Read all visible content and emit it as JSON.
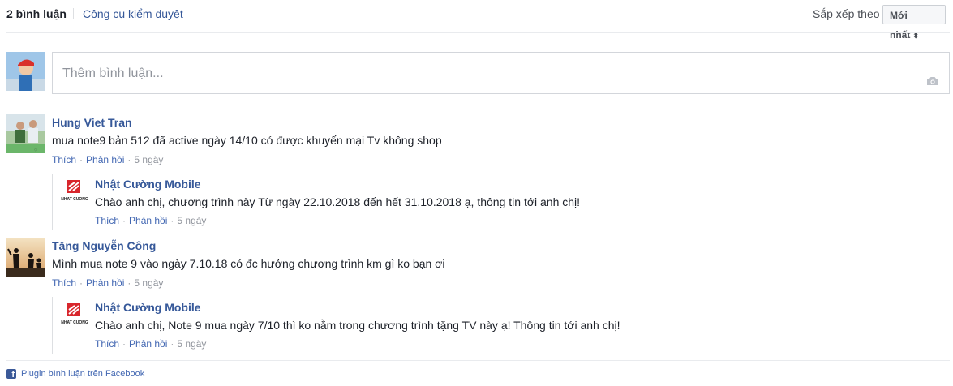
{
  "header": {
    "count_label": "2 bình luận",
    "moderation_label": "Công cụ kiểm duyệt",
    "sort_label": "Sắp xếp theo",
    "sort_value": "Mới nhất"
  },
  "composer": {
    "placeholder": "Thêm bình luận..."
  },
  "comments": [
    {
      "author": "Hung Viet Tran",
      "text": "mua note9 bản 512 đã active ngày 14/10 có được khuyến mại Tv không shop",
      "like": "Thích",
      "reply": "Phản hồi",
      "time": "5 ngày",
      "reply_item": {
        "author": "Nhật Cường Mobile",
        "text": "Chào anh chị, chương trình này Từ ngày 22.10.2018 đến hết 31.10.2018 ạ, thông tin tới anh chị!",
        "like": "Thích",
        "reply": "Phản hồi",
        "time": "5 ngày"
      }
    },
    {
      "author": "Tăng Nguyễn Công",
      "text": "Mình mua note 9 vào ngày 7.10.18 có đc hưởng chương trình km gì ko bạn ơi",
      "like": "Thích",
      "reply": "Phản hồi",
      "time": "5 ngày",
      "reply_item": {
        "author": "Nhật Cường Mobile",
        "text": "Chào anh chị, Note 9 mua ngày 7/10 thì ko nằm trong chương trình tặng TV này ạ! Thông tin tới anh chị!",
        "like": "Thích",
        "reply": "Phản hồi",
        "time": "5 ngày"
      }
    }
  ],
  "brand_logo_text": "NHAT CUONG",
  "footer": {
    "label": "Plugin bình luận trên Facebook"
  }
}
